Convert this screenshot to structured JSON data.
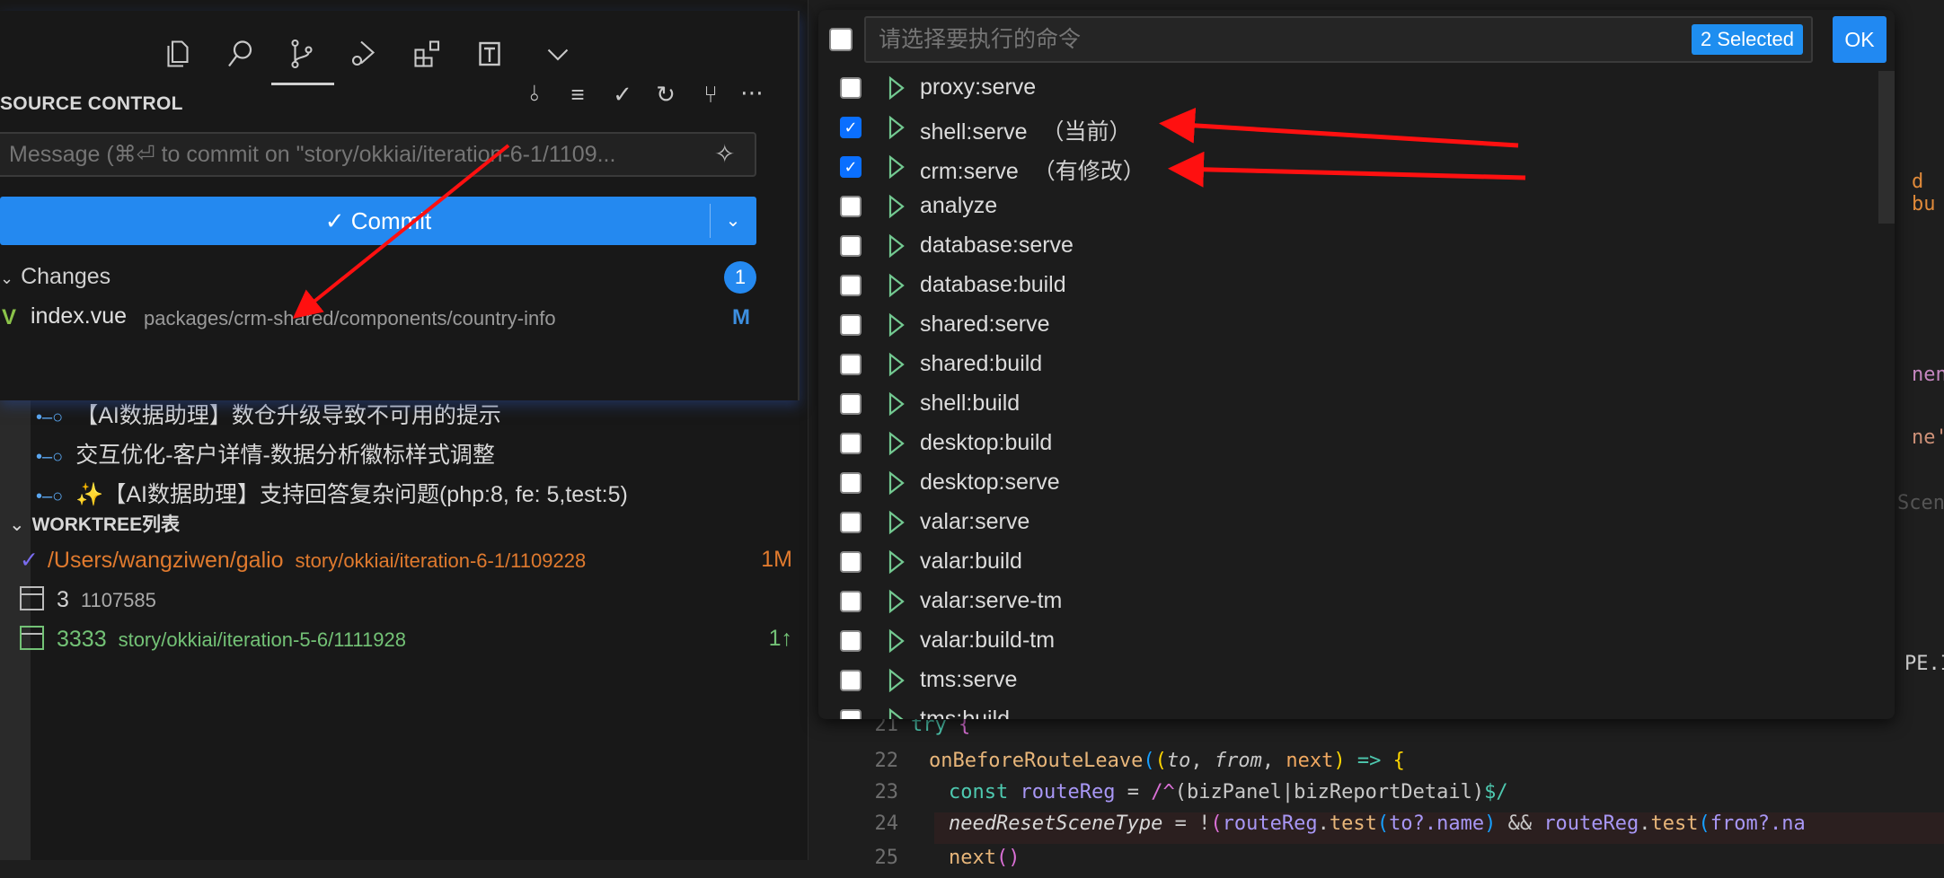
{
  "activity_bar": {
    "icons": [
      "explorer-icon",
      "search-icon",
      "source-control-icon",
      "run-debug-icon",
      "extensions-icon",
      "test-icon",
      "more-chevron-icon"
    ]
  },
  "scm": {
    "title": "SOURCE CONTROL",
    "message_placeholder": "Message (⌘⏎ to commit on \"story/okkiai/iteration-6-1/1109...",
    "commit_label": "✓ Commit",
    "changes_label": "Changes",
    "changes_count": "1",
    "file": {
      "name": "index.vue",
      "path": "packages/crm-shared/components/country-info",
      "status": "M"
    }
  },
  "commits": [
    "【AI数据助理】数仓升级导致不可用的提示",
    "交互优化-客户详情-数据分析徽标样式调整",
    "✨【AI数据助理】支持回答复杂问题(php:8, fe: 5,test:5)"
  ],
  "worktree": {
    "header": "WORKTREE列表",
    "rows": [
      {
        "name": "/Users/wangziwen/galio",
        "branch": "story/okkiai/iteration-6-1/1109228",
        "badge": "1M",
        "color": "#e07a2e"
      },
      {
        "name": "3",
        "branch": "1107585",
        "badge": "",
        "color": "#d0d0d0"
      },
      {
        "name": "3333",
        "branch": "story/okkiai/iteration-5-6/1111928",
        "badge": "1↑",
        "color": "#73c276"
      }
    ]
  },
  "quick_pick": {
    "placeholder": "请选择要执行的命令",
    "selected_count": "2 Selected",
    "ok_label": "OK",
    "items": [
      {
        "label": "proxy:serve",
        "checked": false,
        "note": ""
      },
      {
        "label": "shell:serve",
        "checked": true,
        "note": "（当前）"
      },
      {
        "label": "crm:serve",
        "checked": true,
        "note": "（有修改）"
      },
      {
        "label": "analyze",
        "checked": false,
        "note": ""
      },
      {
        "label": "database:serve",
        "checked": false,
        "note": ""
      },
      {
        "label": "database:build",
        "checked": false,
        "note": ""
      },
      {
        "label": "shared:serve",
        "checked": false,
        "note": ""
      },
      {
        "label": "shared:build",
        "checked": false,
        "note": ""
      },
      {
        "label": "shell:build",
        "checked": false,
        "note": ""
      },
      {
        "label": "desktop:build",
        "checked": false,
        "note": ""
      },
      {
        "label": "desktop:serve",
        "checked": false,
        "note": ""
      },
      {
        "label": "valar:serve",
        "checked": false,
        "note": ""
      },
      {
        "label": "valar:build",
        "checked": false,
        "note": ""
      },
      {
        "label": "valar:serve-tm",
        "checked": false,
        "note": ""
      },
      {
        "label": "valar:build-tm",
        "checked": false,
        "note": ""
      },
      {
        "label": "tms:serve",
        "checked": false,
        "note": ""
      },
      {
        "label": "tms:build",
        "checked": false,
        "note": ""
      }
    ]
  },
  "editor": {
    "edge_fragments": [
      "d bu",
      "nen",
      "ne'",
      "Scen",
      "PE.I"
    ],
    "lines": [
      {
        "n": "21",
        "tokens": [
          [
            "try",
            "#4ec9b0"
          ],
          [
            " {",
            "#da70d6"
          ]
        ]
      },
      {
        "n": "22",
        "tokens": [
          [
            "onBeforeRouteLeave",
            "#e8b67a"
          ],
          [
            "(",
            "#179fff"
          ],
          [
            "(",
            "#ffd700"
          ],
          [
            "to",
            "#c8c8c8"
          ],
          [
            ", ",
            "#c8c8c8"
          ],
          [
            "from",
            "#c8c8c8"
          ],
          [
            ", ",
            "#c8c8c8"
          ],
          [
            "next",
            "#f0a860"
          ],
          [
            ")",
            "#ffd700"
          ],
          [
            " => ",
            "#4ec9b0"
          ],
          [
            "{",
            "#ffd700"
          ]
        ]
      },
      {
        "n": "23",
        "tokens": [
          [
            "const ",
            "#4ec9b0"
          ],
          [
            "routeReg",
            "#a897f5"
          ],
          [
            " = ",
            "#c8c8c8"
          ],
          [
            "/^",
            "#da70d6"
          ],
          [
            "(bizPanel|bizReportDetail)",
            "#c8c8c8"
          ],
          [
            "$/",
            "#4ec9b0"
          ]
        ]
      },
      {
        "n": "24",
        "tokens": [
          [
            "needResetSceneType",
            "#d8d8d8"
          ],
          [
            " = !",
            "#c8c8c8"
          ],
          [
            "(",
            "#da70d6"
          ],
          [
            "routeReg",
            "#a897f5"
          ],
          [
            ".",
            "#c8c8c8"
          ],
          [
            "test",
            "#e8b67a"
          ],
          [
            "(",
            "#179fff"
          ],
          [
            "to?.name",
            "#a897f5"
          ],
          [
            ")",
            "#179fff"
          ],
          [
            " && ",
            "#c8c8c8"
          ],
          [
            "routeReg",
            "#a897f5"
          ],
          [
            ".",
            "#c8c8c8"
          ],
          [
            "test",
            "#e8b67a"
          ],
          [
            "(",
            "#179fff"
          ],
          [
            "from?.na",
            "#a897f5"
          ]
        ]
      },
      {
        "n": "25",
        "tokens": [
          [
            "next",
            "#e8b67a"
          ],
          [
            "()",
            "#da70d6"
          ]
        ]
      }
    ]
  }
}
